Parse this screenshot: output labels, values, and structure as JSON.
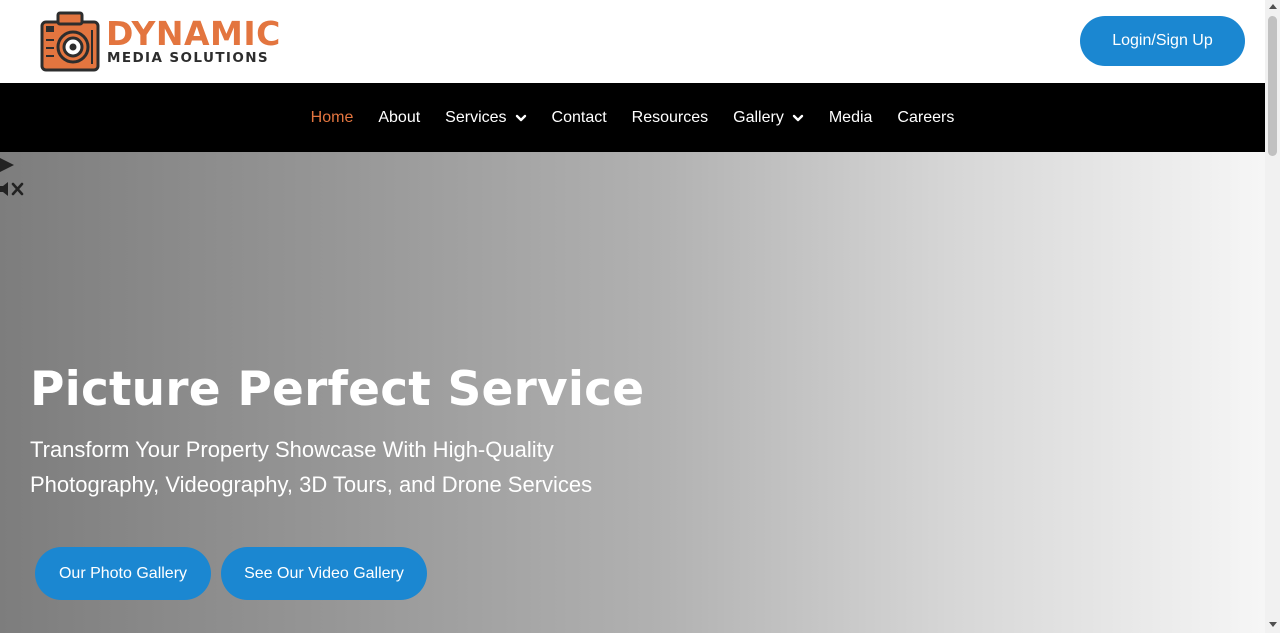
{
  "brand": {
    "line1": "DYNAMIC",
    "line2": "MEDIA SOLUTIONS",
    "logo_icon": "camera-icon",
    "accent_color": "#e3753f"
  },
  "header": {
    "login_label": "Login/Sign Up",
    "button_color": "#1b87d1"
  },
  "nav": {
    "items": [
      {
        "label": "Home",
        "active": true
      },
      {
        "label": "About"
      },
      {
        "label": "Services",
        "has_dropdown": true
      },
      {
        "label": "Contact"
      },
      {
        "label": "Resources"
      },
      {
        "label": "Gallery",
        "has_dropdown": true
      },
      {
        "label": "Media"
      },
      {
        "label": "Careers"
      }
    ]
  },
  "hero": {
    "video_controls": {
      "play_icon": "play-icon",
      "mute_icon": "mute-icon"
    },
    "title": "Picture Perfect Service",
    "subtitle": "Transform Your Property Showcase With High-Quality Photography, Videography, 3D Tours, and Drone Services",
    "buttons": {
      "photo_gallery": "Our Photo Gallery",
      "video_gallery": "See Our Video Gallery"
    }
  }
}
